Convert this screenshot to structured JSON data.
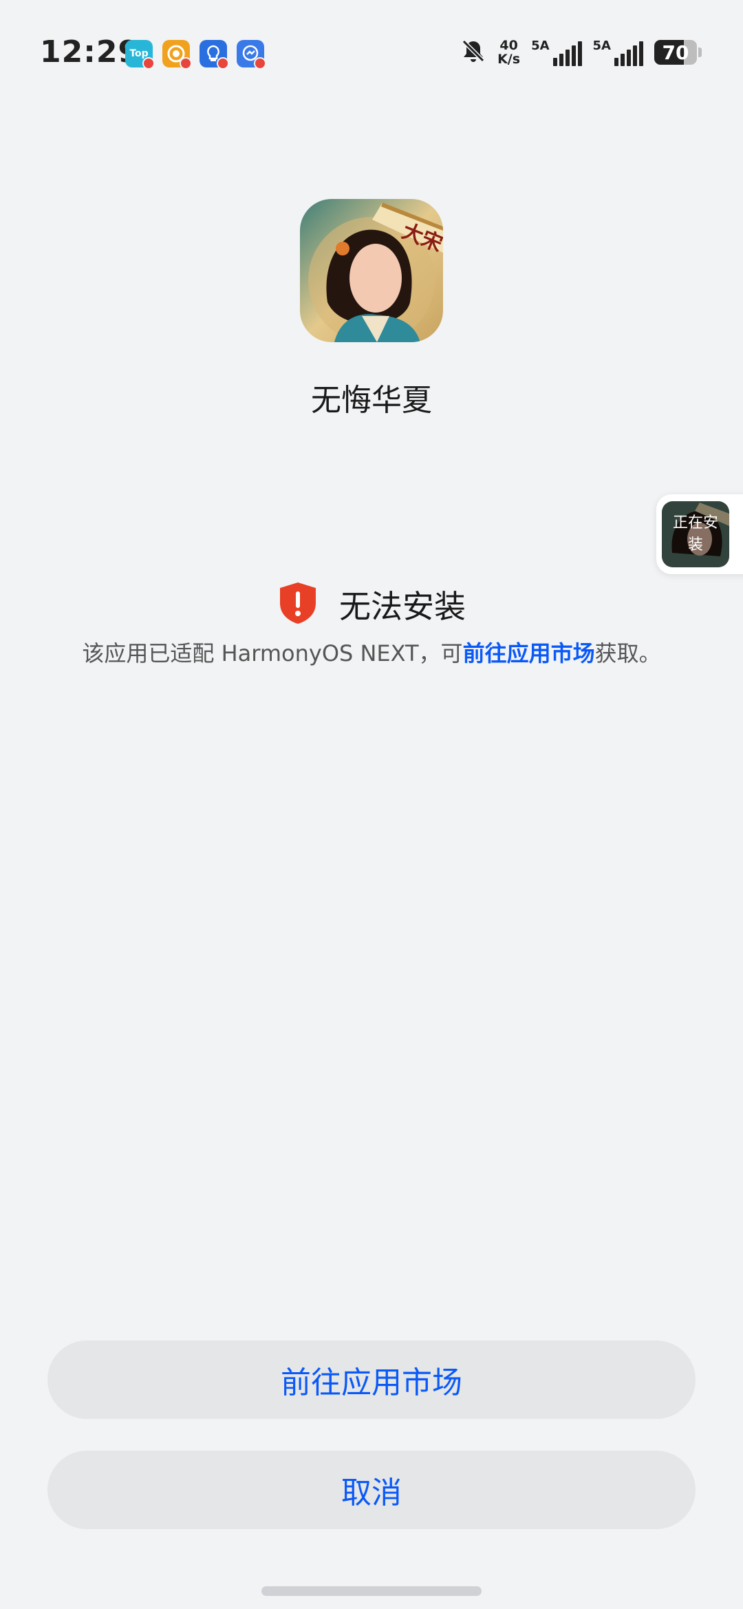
{
  "status_bar": {
    "time": "12:29",
    "notif_icons": [
      {
        "icon": "top-app-icon",
        "label": "Top"
      },
      {
        "icon": "target-app-icon",
        "label": ""
      },
      {
        "icon": "lightbulb-app-icon",
        "label": ""
      },
      {
        "icon": "chat-app-icon",
        "label": ""
      }
    ],
    "bell_icon": "bell-muted-icon",
    "speed_value": "40",
    "speed_unit": "K/s",
    "sim1_tag": "5A",
    "sim2_tag": "5A",
    "battery_level": "70"
  },
  "app": {
    "name": "无悔华夏",
    "icon_banner_text": "大宋"
  },
  "floating": {
    "label": "正在安装"
  },
  "error": {
    "title": "无法安装",
    "desc_prefix": "该应用已适配 HarmonyOS NEXT，可",
    "desc_link": "前往应用市场",
    "desc_suffix": "获取。"
  },
  "buttons": {
    "market_label": "前往应用市场",
    "cancel_label": "取消"
  },
  "colors": {
    "accent": "#0a59f7",
    "error": "#e84026",
    "background": "#f1f3f5",
    "button_bg": "#e5e6e8"
  }
}
